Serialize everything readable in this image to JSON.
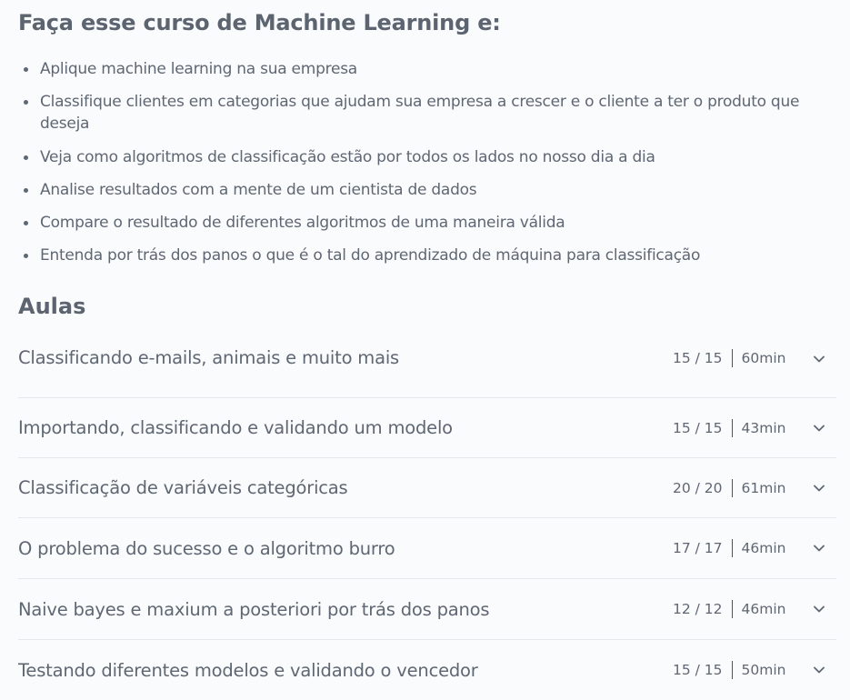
{
  "course": {
    "heading": "Faça esse curso de Machine Learning e:",
    "bullets": [
      "Aplique machine learning na sua empresa",
      "Classifique clientes em categorias que ajudam sua empresa a crescer e o cliente a ter o produto que deseja",
      "Veja como algoritmos de classificação estão por todos os lados no nosso dia a dia",
      "Analise resultados com a mente de um cientista de dados",
      "Compare o resultado de diferentes algoritmos de uma maneira válida",
      "Entenda por trás dos panos o que é o tal do aprendizado de máquina para classificação"
    ]
  },
  "lessons": {
    "heading": "Aulas",
    "items": [
      {
        "title": "Classificando e-mails, animais e muito mais",
        "progress": "15 / 15",
        "duration": "60min"
      },
      {
        "title": "Importando, classificando e validando um modelo",
        "progress": "15 / 15",
        "duration": "43min"
      },
      {
        "title": "Classificação de variáveis categóricas",
        "progress": "20 / 20",
        "duration": "61min"
      },
      {
        "title": "O problema do sucesso e o algoritmo burro",
        "progress": "17 / 17",
        "duration": "46min"
      },
      {
        "title": "Naive bayes e maxium a posteriori por trás dos panos",
        "progress": "12 / 12",
        "duration": "46min"
      },
      {
        "title": "Testando diferentes modelos e validando o vencedor",
        "progress": "15 / 15",
        "duration": "50min"
      }
    ]
  },
  "icons": {
    "expand": "chevron-down-icon"
  },
  "colors": {
    "text": "#5f6773",
    "heading": "#5c6470",
    "divider": "#e4e7ec",
    "background": "#fafbfd"
  }
}
